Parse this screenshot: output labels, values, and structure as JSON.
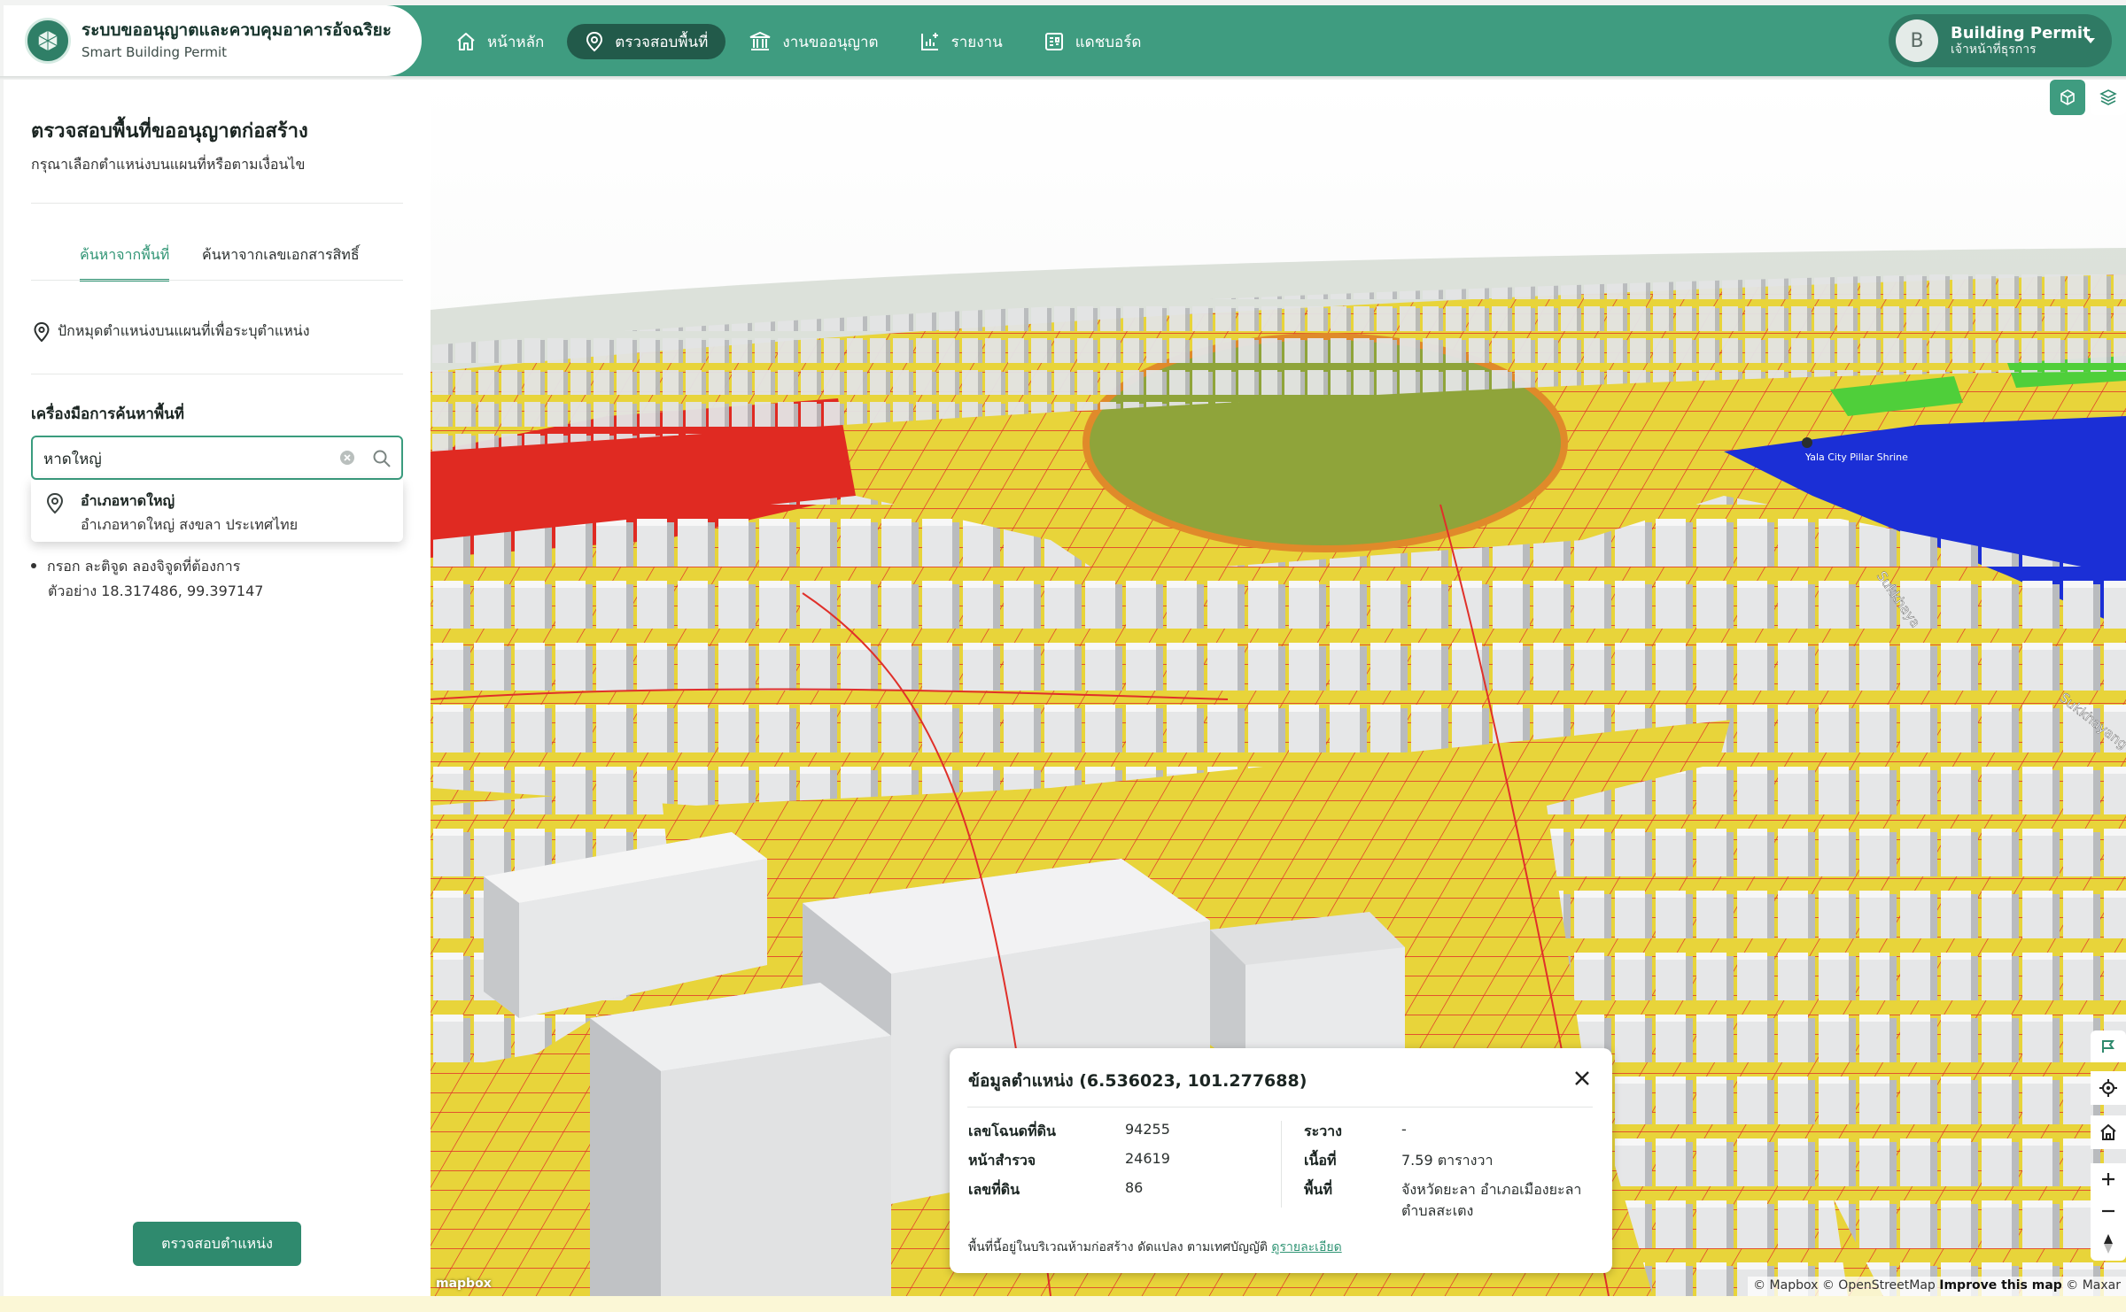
{
  "brand": {
    "title": "ระบบขออนุญาตและควบคุมอาคารอัจฉริยะ",
    "subtitle": "Smart Building Permit"
  },
  "nav": {
    "items": [
      {
        "label": "หน้าหลัก",
        "icon": "home-icon",
        "active": false
      },
      {
        "label": "ตรวจสอบพื้นที่",
        "icon": "location-pin-icon",
        "active": true
      },
      {
        "label": "งานขออนุญาต",
        "icon": "building-icon",
        "active": false
      },
      {
        "label": "รายงาน",
        "icon": "report-chart-icon",
        "active": false
      },
      {
        "label": "แดชบอร์ด",
        "icon": "dashboard-icon",
        "active": false
      }
    ]
  },
  "user": {
    "initial": "B",
    "name": "Building Permit",
    "role": "เจ้าหน้าที่ธุรการ"
  },
  "sidebar": {
    "title": "ตรวจสอบพื้นที่ขออนุญาตก่อสร้าง",
    "subtitle": "กรุณาเลือกตำแหน่งบนแผนที่หรือตามเงื่อนไข",
    "tabs": [
      {
        "label": "ค้นหาจากพื้นที่",
        "active": true
      },
      {
        "label": "ค้นหาจากเลขเอกสารสิทธิ์",
        "active": false
      }
    ],
    "pin_instruction": "ปักหมุดตำแหน่งบนแผนที่เพื่อระบุตำแหน่ง",
    "tools_label": "เครื่องมือการค้นหาพื้นที่",
    "search": {
      "value": "หาดใหญ่",
      "placeholder": ""
    },
    "suggestion": {
      "title": "อำเภอหาดใหญ่",
      "subtitle": "อำเภอหาดใหญ่ สงขลา ประเทศไทย"
    },
    "hint_line1": "กรอก ละติจูด ลองจิจูดที่ต้องการ",
    "hint_line2": "ตัวอย่าง 18.317486, 99.397147",
    "check_button": "ตรวจสอบตำแหน่ง"
  },
  "map": {
    "attribution_prefix": "© Mapbox © OpenStreetMap",
    "attribution_improve": "Improve this map",
    "attribution_suffix": "© Maxar",
    "logo": "mapbox",
    "labels": [
      "Sukkhaya",
      "Sukkhayang",
      "Yala City Pillar Shrine"
    ],
    "colors": {
      "yellow_zone": "#e8d43a",
      "red_zone": "#e02a22",
      "green_zone": "#8fa43a",
      "blue_zone": "#1b2fd6",
      "parcel_lines": "#e0302a",
      "buildings": "#e4e5e6"
    }
  },
  "info": {
    "title": "ข้อมูลตำแหน่ง (6.536023, 101.277688)",
    "left": [
      {
        "label": "เลขโฉนดที่ดิน",
        "value": "94255"
      },
      {
        "label": "หน้าสำรวจ",
        "value": "24619"
      },
      {
        "label": "เลขที่ดิน",
        "value": "86"
      }
    ],
    "right": [
      {
        "label": "ระวาง",
        "value": "-"
      },
      {
        "label": "เนื้อที่",
        "value": "7.59 ตารางวา"
      },
      {
        "label": "พื้นที่",
        "value": "จังหวัดยะลา อำเภอเมืองยะลา"
      },
      {
        "label": "",
        "value": "ตำบลสะเตง"
      }
    ],
    "note": "พื้นที่นี้อยู่ในบริเวณห้ามก่อสร้าง ดัดแปลง ตามเทศบัญญัติ",
    "note_link": "ดูรายละเอียด"
  },
  "accent_color": "#3f9c80"
}
